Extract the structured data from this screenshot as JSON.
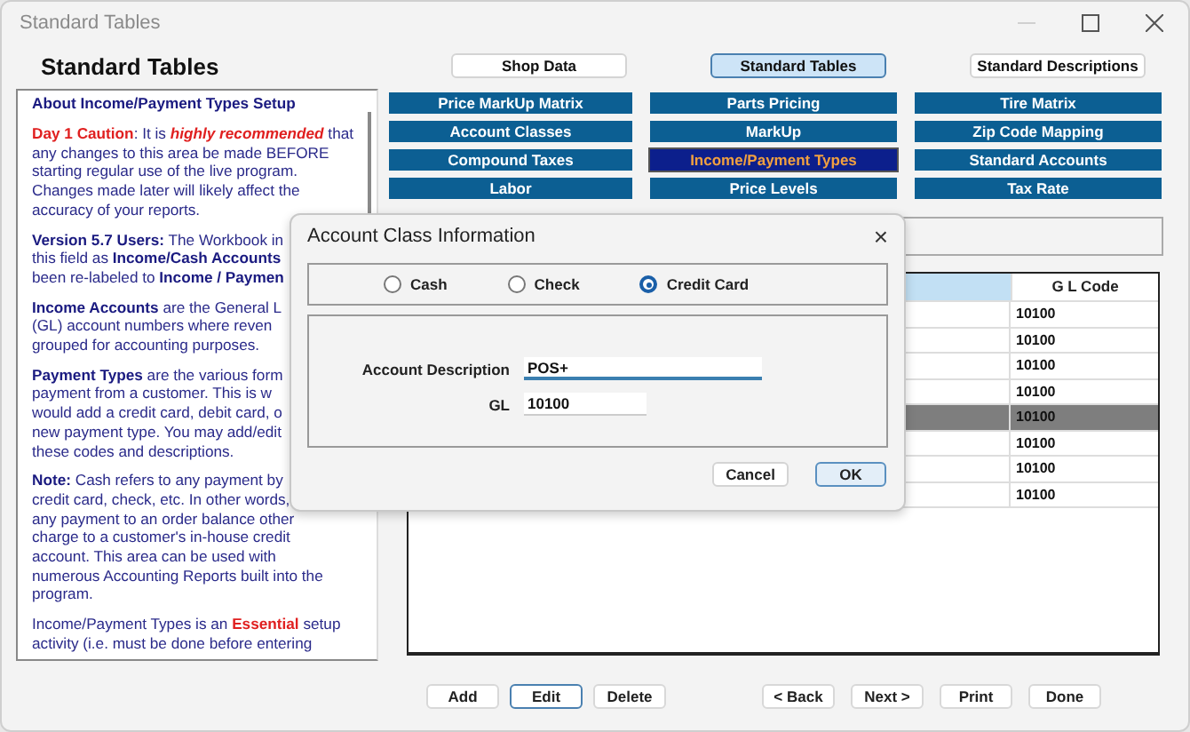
{
  "window": {
    "title": "Standard Tables"
  },
  "heading": "Standard Tables",
  "top_buttons": [
    {
      "label": "Shop Data",
      "selected": false
    },
    {
      "label": "Standard Tables",
      "selected": true
    },
    {
      "label": "Standard Descriptions",
      "selected": false
    }
  ],
  "help": [
    {
      "kind": "heading",
      "lines": [
        "About Income/Payment Types Setup"
      ]
    },
    {
      "kind": "caution",
      "lines": [
        "**Day 1 Caution**: It is *highly recommended* that",
        "any changes to this area be made BEFORE",
        "starting regular use of the live program.",
        "Changes made later will likely affect the",
        "accuracy of your reports."
      ]
    },
    {
      "kind": "normal",
      "lines": [
        "**Version 5.7 Users:** The Workbook in",
        "this field as **Income/Cash Accounts**",
        "been re-labeled to **Income / Paymen**"
      ]
    },
    {
      "kind": "normal",
      "lines": [
        "**Income Accounts** are the General L",
        "(GL) account numbers where reven",
        "grouped for accounting purposes."
      ]
    },
    {
      "kind": "normal",
      "lines": [
        "**Payment Types** are the various form",
        "payment from a customer. This is w",
        "would add a credit card, debit card, o",
        "new payment type. You may add/edit",
        "these codes and descriptions."
      ]
    },
    {
      "kind": "normal",
      "lines": [
        "**Note:** Cash refers to any payment by",
        "credit card, check, etc. In other words,",
        "any payment to an order balance other",
        "charge to a customer's in-house credit",
        "account. This area can be used with",
        "numerous Accounting Reports built into the",
        "program."
      ]
    },
    {
      "kind": "caution",
      "lines": [
        "Income/Payment Types is an **Essential** setup",
        "activity (i.e. must be done before entering"
      ]
    }
  ],
  "nav_buttons": [
    {
      "label": "Price MarkUp Matrix",
      "selected": false
    },
    {
      "label": "Parts Pricing",
      "selected": false
    },
    {
      "label": "Tire Matrix",
      "selected": false
    },
    {
      "label": "Account Classes",
      "selected": false
    },
    {
      "label": "MarkUp",
      "selected": false
    },
    {
      "label": "Zip Code Mapping",
      "selected": false
    },
    {
      "label": "Compound Taxes",
      "selected": false
    },
    {
      "label": "Income/Payment Types",
      "selected": true
    },
    {
      "label": "Standard Accounts",
      "selected": false
    },
    {
      "label": "Labor",
      "selected": false
    },
    {
      "label": "Price Levels",
      "selected": false
    },
    {
      "label": "Tax Rate",
      "selected": false
    }
  ],
  "table": {
    "columns": [
      "G L Code"
    ],
    "rows": [
      {
        "gl_code": "10100",
        "selected": false
      },
      {
        "gl_code": "10100",
        "selected": false
      },
      {
        "gl_code": "10100",
        "selected": false
      },
      {
        "gl_code": "10100",
        "selected": false
      },
      {
        "gl_code": "10100",
        "selected": true
      },
      {
        "gl_code": "10100",
        "selected": false
      },
      {
        "gl_code": "10100",
        "selected": false
      },
      {
        "gl_code": "10100",
        "selected": false
      }
    ]
  },
  "bottom_buttons_left": [
    {
      "label": "Add",
      "focused": false
    },
    {
      "label": "Edit",
      "focused": true
    },
    {
      "label": "Delete",
      "focused": false
    }
  ],
  "bottom_buttons_right": [
    {
      "label": "< Back",
      "focused": false
    },
    {
      "label": "Next >",
      "focused": false
    },
    {
      "label": "Print",
      "focused": false
    },
    {
      "label": "Done",
      "focused": false
    }
  ],
  "dialog": {
    "title": "Account Class Information",
    "close": "×",
    "options": [
      {
        "label": "Cash",
        "selected": false
      },
      {
        "label": "Check",
        "selected": false
      },
      {
        "label": "Credit Card",
        "selected": true
      }
    ],
    "fields": [
      {
        "label": "Account Description",
        "value": "POS+",
        "focused": true
      },
      {
        "label": "GL",
        "value": "10100",
        "focused": false
      }
    ],
    "buttons": [
      {
        "label": "Cancel",
        "default": false
      },
      {
        "label": "OK",
        "default": true
      }
    ]
  }
}
